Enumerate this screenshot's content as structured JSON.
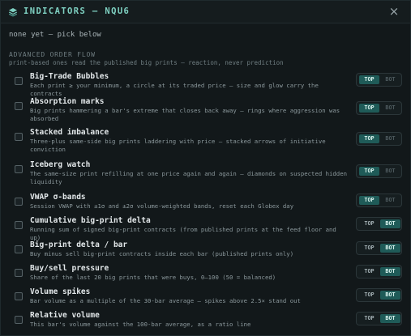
{
  "header": {
    "title": "INDICATORS — NQU6",
    "close_glyph": "×",
    "logo_icon": "layers-icon",
    "accent": "#7fd1c2"
  },
  "status_text": "none yet — pick below",
  "section": {
    "heading": "ADVANCED ORDER FLOW",
    "subheading": "print-based ones read the published big prints — reaction, never prediction"
  },
  "toggle_labels": {
    "top": "TOP",
    "bot": "BOT"
  },
  "indicators": [
    {
      "name": "Big-Trade Bubbles",
      "desc": "Each print ≥ your minimum, a circle at its traded price — size and glow carry the contracts",
      "placement": "TOP",
      "checked": false
    },
    {
      "name": "Absorption marks",
      "desc": "Big prints hammering a bar's extreme that closes back away — rings where aggression was absorbed",
      "placement": "TOP",
      "checked": false
    },
    {
      "name": "Stacked imbalance",
      "desc": "Three-plus same-side big prints laddering with price — stacked arrows of initiative conviction",
      "placement": "TOP",
      "checked": false
    },
    {
      "name": "Iceberg watch",
      "desc": "The same-size print refilling at one price again and again — diamonds on suspected hidden liquidity",
      "placement": "TOP",
      "checked": false
    },
    {
      "name": "VWAP σ-bands",
      "desc": "Session VWAP with ±1σ and ±2σ volume-weighted bands, reset each Globex day",
      "placement": "TOP",
      "checked": false
    },
    {
      "name": "Cumulative big-print delta",
      "desc": "Running sum of signed big-print contracts (from published prints at the feed floor and up)",
      "placement": "BOT",
      "checked": false
    },
    {
      "name": "Big-print delta / bar",
      "desc": "Buy minus sell big-print contracts inside each bar (published prints only)",
      "placement": "BOT",
      "checked": false
    },
    {
      "name": "Buy/sell pressure",
      "desc": "Share of the last 20 big prints that were buys, 0–100 (50 = balanced)",
      "placement": "BOT",
      "checked": false
    },
    {
      "name": "Volume spikes",
      "desc": "Bar volume as a multiple of the 30-bar average — spikes above 2.5× stand out",
      "placement": "BOT",
      "checked": false
    },
    {
      "name": "Relative volume",
      "desc": "This bar's volume against the 100-bar average, as a ratio line",
      "placement": "BOT",
      "checked": false
    }
  ]
}
